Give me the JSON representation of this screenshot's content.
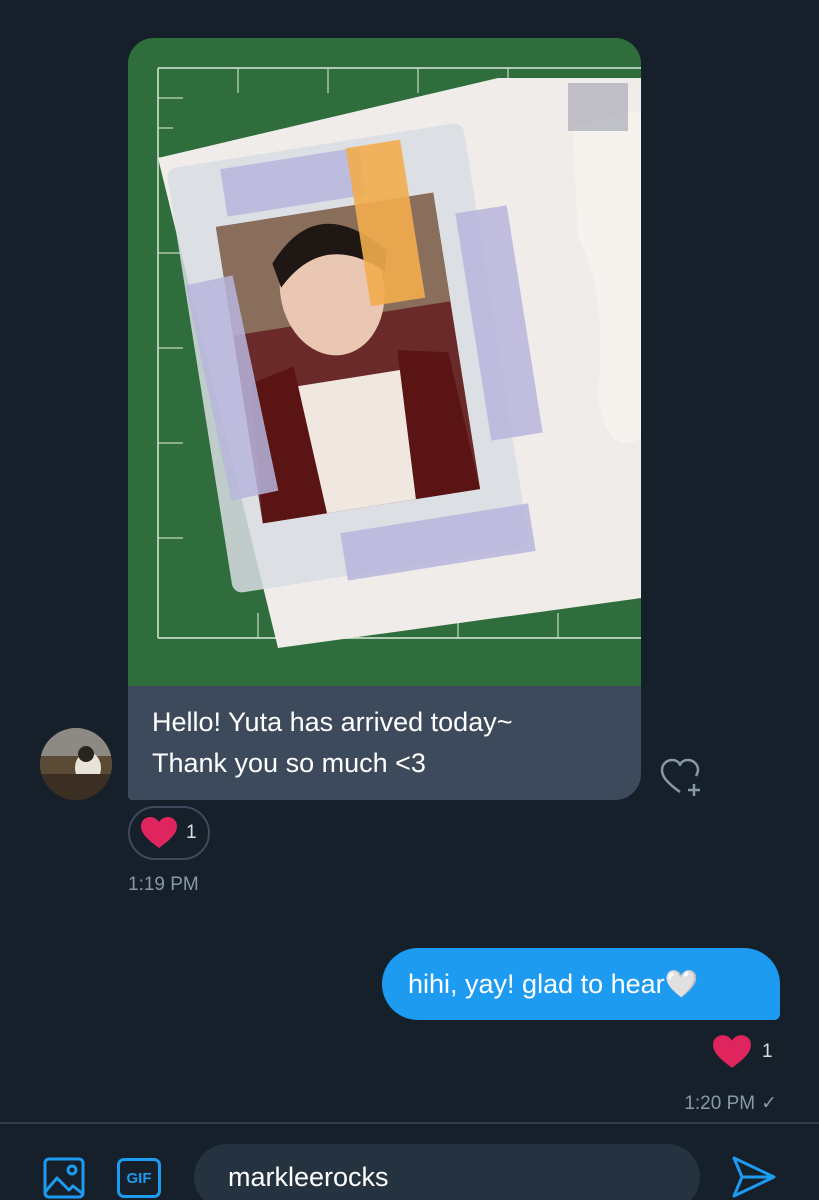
{
  "conversation": {
    "incoming": {
      "media": {
        "icon": "photo-of-yuta-photocard"
      },
      "text": "Hello! Yuta has arrived today~\nThank you so much <3",
      "reaction": {
        "emoji": "heart",
        "count": "1"
      },
      "time": "1:19 PM"
    },
    "outgoing": {
      "text": "hihi, yay! glad to hear🤍",
      "reaction": {
        "emoji": "heart",
        "count": "1"
      },
      "time": "1:20 PM",
      "status": "✓"
    }
  },
  "composer": {
    "gif_label": "GIF",
    "input_value": "markleerocks"
  },
  "colors": {
    "background": "#15202b",
    "incoming_bubble": "#3d4a5c",
    "outgoing_bubble": "#1d9bf0",
    "accent": "#1d9bf0",
    "heart": "#e0245e",
    "muted_text": "#8899a6"
  }
}
